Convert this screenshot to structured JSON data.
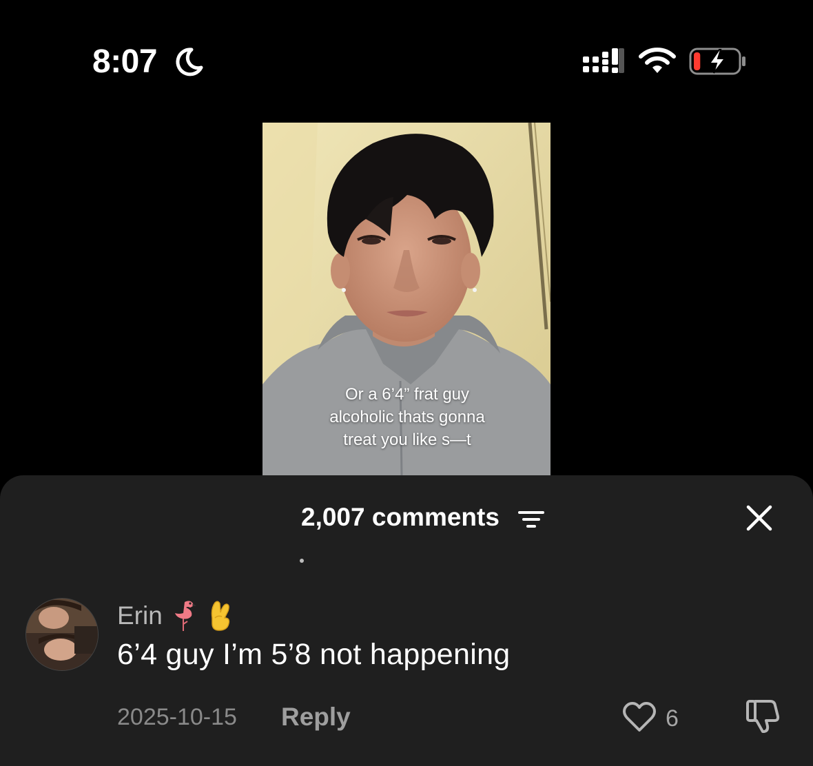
{
  "status_bar": {
    "time": "8:07",
    "focus_icon": "moon-icon",
    "signal_icon": "cellular-signal-icon",
    "wifi_icon": "wifi-icon",
    "battery_icon": "battery-charging-icon",
    "battery_level": 0.15,
    "battery_color": "#ff3b30"
  },
  "video": {
    "caption_lines": [
      "Or a 6’4” frat guy",
      "alcoholic thats gonna",
      "treat you like s—t"
    ]
  },
  "comments_panel": {
    "count_label": "2,007 comments",
    "sort_icon": "filter-sort-icon",
    "close_icon": "close-icon",
    "comment": {
      "username": "Erin",
      "username_emojis": [
        "flamingo-emoji",
        "crossed-fingers-emoji"
      ],
      "text": "6’4 guy I’m 5’8 not happening",
      "date": "2025-10-15",
      "reply_label": "Reply",
      "like_count": "6",
      "like_icon": "heart-outline-icon",
      "dislike_icon": "thumbs-down-icon"
    }
  },
  "colors": {
    "background": "#000000",
    "sheet": "#1f1f1f",
    "muted_text": "#8a8a8a"
  }
}
